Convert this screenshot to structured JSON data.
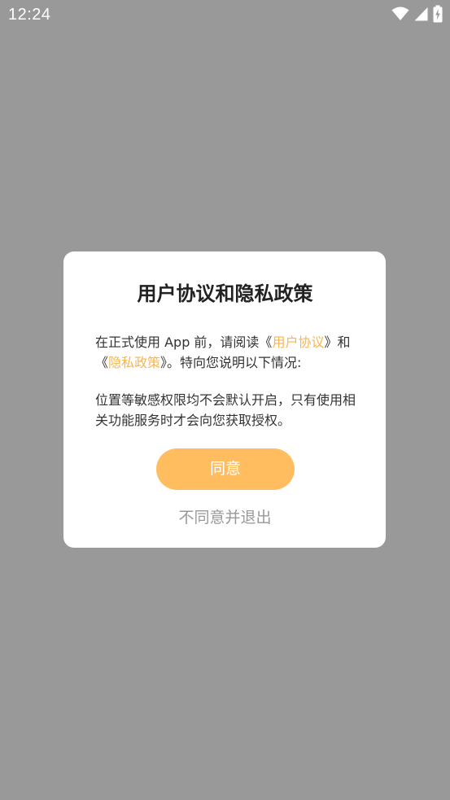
{
  "status_bar": {
    "time": "12:24",
    "icons": [
      "wifi-icon",
      "cell-signal-icon",
      "battery-charging-icon"
    ],
    "icon_color": "#ffffff"
  },
  "overlay_color": "#999999",
  "dialog": {
    "title": "用户协议和隐私政策",
    "intro": {
      "part1": "在正式使用 App 前，请阅读《",
      "link_user_agreement": "用户协议",
      "part2": "》和《",
      "link_privacy_policy": "隐私政策",
      "part3": "》。特向您说明以下情况:"
    },
    "notice": "位置等敏感权限均不会默认开启，只有使用相关功能服务时才会向您获取授权。",
    "agree_label": "同意",
    "disagree_label": "不同意并退出",
    "accent_color": "#f8b552",
    "button_color": "#ffbd60"
  }
}
